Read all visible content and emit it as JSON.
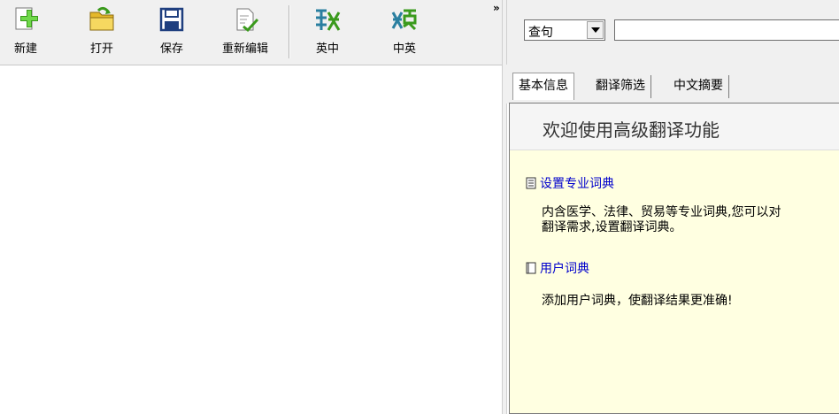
{
  "toolbar": {
    "buttons": [
      {
        "label": "新建",
        "icon": "new-document-icon"
      },
      {
        "label": "打开",
        "icon": "open-folder-icon"
      },
      {
        "label": "保存",
        "icon": "save-disk-icon"
      },
      {
        "label": "重新编辑",
        "icon": "edit-document-icon"
      },
      {
        "label": "英中",
        "icon": "translate-en-zh-icon"
      },
      {
        "label": "中英",
        "icon": "translate-zh-en-icon"
      }
    ],
    "overflow_label": "»"
  },
  "search": {
    "mode_value": "查句",
    "query_value": ""
  },
  "tabs": [
    {
      "label": "基本信息",
      "active": true
    },
    {
      "label": "翻译筛选",
      "active": false
    },
    {
      "label": "中文摘要",
      "active": false
    }
  ],
  "welcome": {
    "title": "欢迎使用高级翻译功能",
    "sections": [
      {
        "link": "设置专业词典",
        "lines": [
          "内含医学、法律、贸易等专业词典,您可以对",
          "翻译需求,设置翻译词典。"
        ]
      },
      {
        "link": "用户词典",
        "lines": [
          "添加用户词典，使翻译结果更准确!"
        ]
      }
    ]
  },
  "colors": {
    "toolbar_bg": "#f0f0f0",
    "content_bg": "#ffffe1",
    "link": "#0000cc",
    "icon_green": "#3a9a1c",
    "icon_blue": "#1f3f7f"
  }
}
